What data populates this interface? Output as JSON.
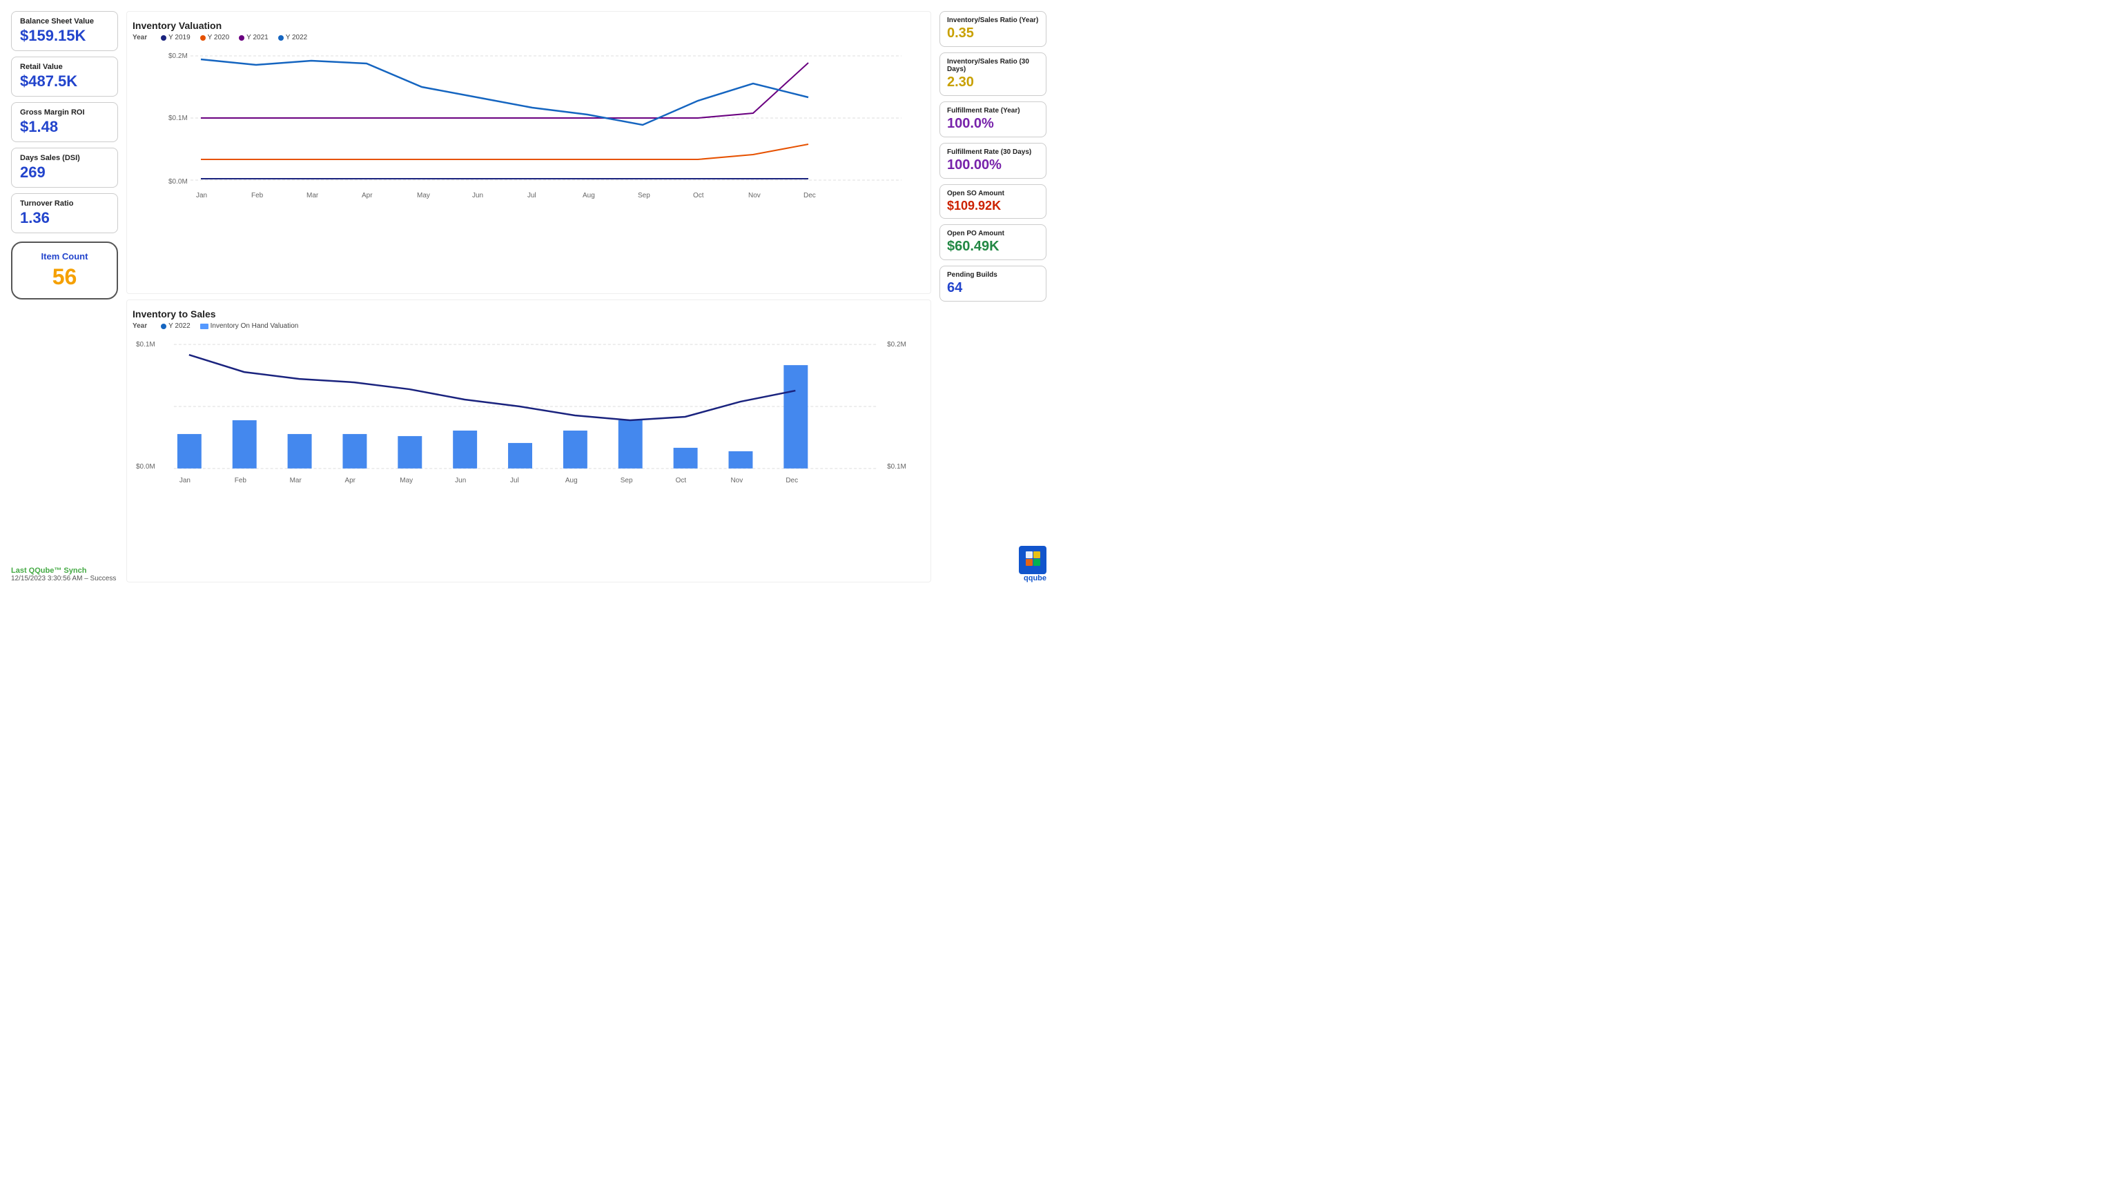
{
  "left": {
    "balance_sheet_label": "Balance Sheet Value",
    "balance_sheet_value": "$159.15K",
    "retail_label": "Retail Value",
    "retail_value": "$487.5K",
    "gross_margin_label": "Gross Margin ROI",
    "gross_margin_value": "$1.48",
    "days_sales_label": "Days Sales (DSI)",
    "days_sales_value": "269",
    "turnover_label": "Turnover Ratio",
    "turnover_value": "1.36",
    "item_count_label": "Item Count",
    "item_count_value": "56",
    "sync_title": "Last QQube™ Synch",
    "sync_detail": "12/15/2023 3:30:56 AM – Success"
  },
  "charts": {
    "inv_valuation_title": "Inventory Valuation",
    "inv_valuation_legend_year": "Year",
    "inv_to_sales_title": "Inventory to Sales",
    "inv_to_sales_legend_year": "Year",
    "legend_y2019": "Y 2019",
    "legend_y2020": "Y 2020",
    "legend_y2021": "Y 2021",
    "legend_y2022": "Y 2022",
    "legend_y2022b": "Y 2022",
    "legend_inv_on_hand": "Inventory On Hand Valuation",
    "months": [
      "Jan",
      "Feb",
      "Mar",
      "Apr",
      "May",
      "Jun",
      "Jul",
      "Aug",
      "Sep",
      "Oct",
      "Nov",
      "Dec"
    ]
  },
  "right": {
    "inv_sales_year_label": "Inventory/Sales Ratio (Year)",
    "inv_sales_year_value": "0.35",
    "inv_sales_30_label": "Inventory/Sales Ratio (30 Days)",
    "inv_sales_30_value": "2.30",
    "fulfill_year_label": "Fulfillment Rate (Year)",
    "fulfill_year_value": "100.0%",
    "fulfill_30_label": "Fulfillment Rate (30 Days)",
    "fulfill_30_value": "100.00%",
    "open_so_label": "Open SO Amount",
    "open_so_value": "$109.92K",
    "open_po_label": "Open PO Amount",
    "open_po_value": "$60.49K",
    "pending_builds_label": "Pending Builds",
    "pending_builds_value": "64"
  }
}
